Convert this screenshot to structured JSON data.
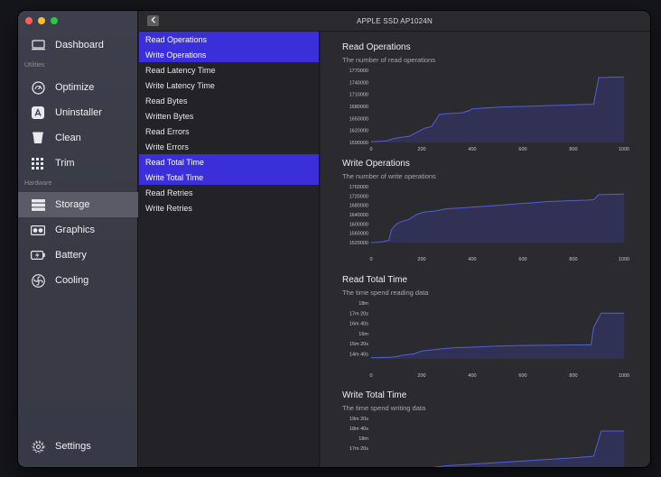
{
  "window": {
    "title": "APPLE SSD AP1024N"
  },
  "colors": {
    "accent": "#3a2fd8",
    "line": "#5060d8",
    "area": "#31325a"
  },
  "sidebar": {
    "top": [
      {
        "label": "Dashboard",
        "icon": "monitor-icon"
      }
    ],
    "utilities_label": "Utilities",
    "utilities": [
      {
        "label": "Optimize",
        "icon": "gauge-icon"
      },
      {
        "label": "Uninstaller",
        "icon": "app-store-icon"
      },
      {
        "label": "Clean",
        "icon": "trash-icon"
      },
      {
        "label": "Trim",
        "icon": "grid-icon"
      }
    ],
    "hardware_label": "Hardware",
    "hardware": [
      {
        "label": "Storage",
        "icon": "drive-icon",
        "active": true
      },
      {
        "label": "Graphics",
        "icon": "gpu-icon"
      },
      {
        "label": "Battery",
        "icon": "battery-icon"
      },
      {
        "label": "Cooling",
        "icon": "fan-icon"
      }
    ],
    "settings": {
      "label": "Settings",
      "icon": "gear-icon"
    }
  },
  "metrics": [
    {
      "label": "Read Operations",
      "selected": true
    },
    {
      "label": "Write Operations",
      "selected": true
    },
    {
      "label": "Read Latency Time",
      "selected": false
    },
    {
      "label": "Write Latency Time",
      "selected": false
    },
    {
      "label": "Read Bytes",
      "selected": false
    },
    {
      "label": "Written Bytes",
      "selected": false
    },
    {
      "label": "Read Errors",
      "selected": false
    },
    {
      "label": "Write Errors",
      "selected": false
    },
    {
      "label": "Read Total Time",
      "selected": true
    },
    {
      "label": "Write Total Time",
      "selected": true
    },
    {
      "label": "Read Retries",
      "selected": false
    },
    {
      "label": "Write Retries",
      "selected": false
    }
  ],
  "chart_data": [
    {
      "type": "area",
      "title": "Read Operations",
      "subtitle": "The number of read operations",
      "y_tick_labels": [
        "1770000",
        "1740000",
        "1710000",
        "1680000",
        "1650000",
        "1620000",
        "1590000"
      ],
      "ylim": [
        1590000,
        1770000
      ],
      "x_ticks": [
        "0",
        "200",
        "400",
        "600",
        "800",
        "1000"
      ],
      "xlim": [
        0,
        1000
      ],
      "x": [
        0,
        30,
        60,
        90,
        120,
        150,
        180,
        210,
        240,
        270,
        300,
        330,
        360,
        390,
        400,
        450,
        500,
        550,
        600,
        650,
        700,
        750,
        800,
        850,
        880,
        900,
        920,
        950,
        1000
      ],
      "y": [
        1592000,
        1593000,
        1594000,
        1600000,
        1603000,
        1605000,
        1615000,
        1625000,
        1630000,
        1660000,
        1662000,
        1663000,
        1664000,
        1670000,
        1674000,
        1676000,
        1678000,
        1679000,
        1680000,
        1681000,
        1682000,
        1683000,
        1684000,
        1685000,
        1685000,
        1752000,
        1752000,
        1753000,
        1753000
      ]
    },
    {
      "type": "area",
      "title": "Write Operations",
      "subtitle": "The number of write operations",
      "y_tick_labels": [
        "1760000",
        "1720000",
        "1680000",
        "1640000",
        "1600000",
        "1560000",
        "1520000"
      ],
      "ylim": [
        1520000,
        1760000
      ],
      "x_ticks": [
        "0",
        "200",
        "400",
        "600",
        "800",
        "1000"
      ],
      "xlim": [
        0,
        1000
      ],
      "x": [
        0,
        40,
        70,
        80,
        100,
        120,
        150,
        180,
        200,
        220,
        250,
        300,
        350,
        400,
        450,
        500,
        550,
        600,
        650,
        700,
        750,
        800,
        850,
        880,
        900,
        920,
        950,
        1000
      ],
      "y": [
        1520000,
        1522000,
        1530000,
        1575000,
        1600000,
        1610000,
        1620000,
        1640000,
        1648000,
        1652000,
        1655000,
        1665000,
        1668000,
        1672000,
        1676000,
        1680000,
        1684000,
        1688000,
        1692000,
        1696000,
        1698000,
        1700000,
        1702000,
        1704000,
        1725000,
        1726000,
        1727000,
        1728000
      ]
    },
    {
      "type": "area",
      "title": "Read Total Time",
      "subtitle": "The time spend reading data",
      "y_tick_labels": [
        "18m",
        "17m 20s",
        "16m 40s",
        "16m",
        "15m 20s",
        "14m 40s"
      ],
      "ylim": [
        0,
        5
      ],
      "x_ticks": [
        "0",
        "200",
        "400",
        "600",
        "800",
        "1000"
      ],
      "xlim": [
        0,
        1000
      ],
      "x": [
        0,
        40,
        80,
        100,
        130,
        170,
        200,
        240,
        280,
        330,
        400,
        450,
        500,
        600,
        700,
        800,
        870,
        880,
        910,
        1000
      ],
      "y": [
        0.1,
        0.12,
        0.15,
        0.2,
        0.35,
        0.45,
        0.7,
        0.8,
        0.9,
        1.0,
        1.05,
        1.1,
        1.15,
        1.2,
        1.22,
        1.25,
        1.25,
        2.8,
        4.1,
        4.1
      ]
    },
    {
      "type": "area",
      "title": "Write Total Time",
      "subtitle": "The time spend writing data",
      "y_tick_labels": [
        "19m 20s",
        "18m 40s",
        "18m",
        "17m 20s"
      ],
      "ylim": [
        0,
        4
      ],
      "x_ticks": [],
      "xlim": [
        0,
        1000
      ],
      "x": [
        0,
        60,
        100,
        140,
        160,
        200,
        250,
        300,
        350,
        400,
        450,
        500,
        600,
        700,
        800,
        880,
        910,
        1000
      ],
      "y": [
        -0.8,
        -0.6,
        0.0,
        0.5,
        0.7,
        0.8,
        0.9,
        1.0,
        1.05,
        1.1,
        1.15,
        1.2,
        1.3,
        1.4,
        1.5,
        1.6,
        3.2,
        3.2
      ]
    }
  ]
}
